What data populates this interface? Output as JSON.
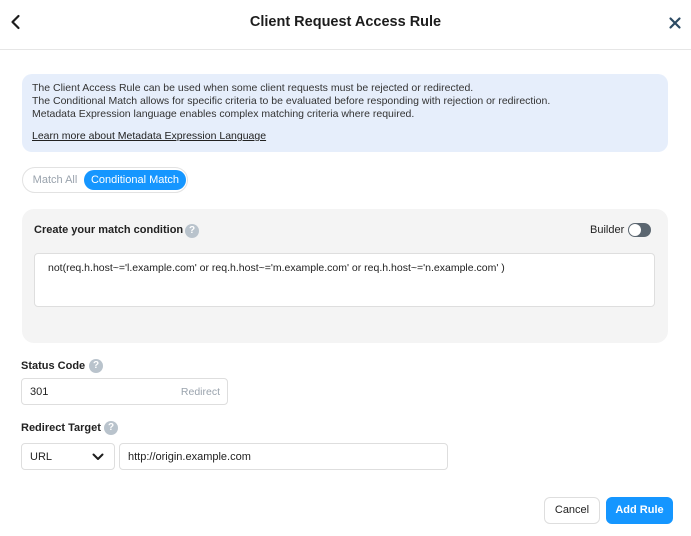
{
  "header": {
    "title": "Client Request Access Rule",
    "back_icon": "chevron-left-icon",
    "close_icon": "close-icon"
  },
  "info": {
    "line1": "The Client Access Rule can be used when some client requests must be rejected or redirected.",
    "line2": "The Conditional Match allows for specific criteria to be evaluated before responding with rejection or redirection.",
    "line3": "Metadata Expression language enables complex matching criteria where required.",
    "link": "Learn more about Metadata Expression Language"
  },
  "match_mode": {
    "options": [
      "Match All",
      "Conditional Match"
    ],
    "selected": "Conditional Match"
  },
  "condition": {
    "label": "Create your match condition",
    "builder_label": "Builder",
    "builder_enabled": false,
    "expression": "not(req.h.host~='l.example.com' or req.h.host~='m.example.com' or req.h.host~='n.example.com' )"
  },
  "status_code": {
    "label": "Status Code",
    "value": "301",
    "suffix": "Redirect"
  },
  "redirect_target": {
    "label": "Redirect Target",
    "type": "URL",
    "url": "http://origin.example.com"
  },
  "footer": {
    "cancel_label": "Cancel",
    "add_label": "Add Rule"
  },
  "colors": {
    "accent": "#1596ff",
    "info_bg": "#e6eefb",
    "panel_bg": "#f4f4f4"
  }
}
